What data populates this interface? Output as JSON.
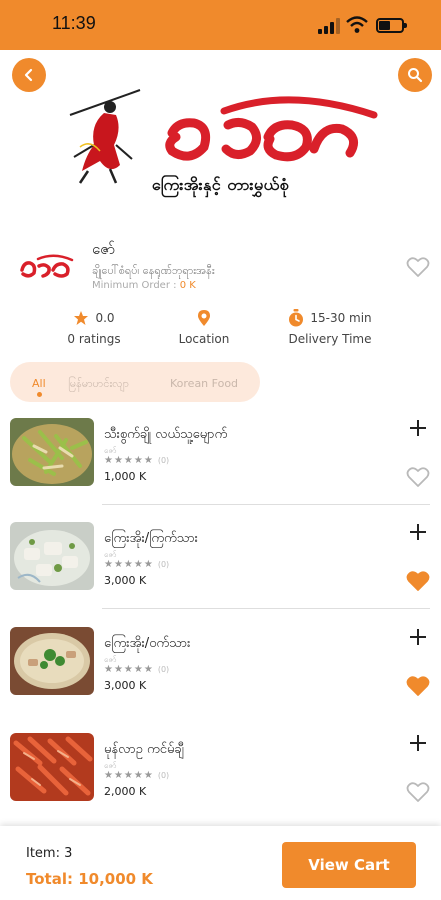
{
  "status_bar": {
    "time": "11:39"
  },
  "hero": {
    "brand_script": "ဇော်",
    "subtitle": "ကြေးအိုးနှင့် တားမွှယ်စုံ"
  },
  "restaurant": {
    "name": "ဇော်",
    "address": "ချိုပေါ်စံရပ်၊ နေရုဏ်ဘုရားအနီး",
    "min_order_label": "Minimum Order :",
    "min_order_value": "0 K",
    "rating_value": "0.0",
    "rating_label": "0 ratings",
    "location_label": "Location",
    "delivery_value": "15-30 min",
    "delivery_label": "Delivery Time"
  },
  "tabs": [
    {
      "label": "All",
      "active": true
    },
    {
      "label": "မြန်မာဟင်းလျာ",
      "active": false
    },
    {
      "label": "Korean Food",
      "active": false
    }
  ],
  "menu": [
    {
      "name": "သီးစွက်ချို လယ်သူ့မျောက်",
      "shop": "ဇော်",
      "stars": "★★★★★",
      "count": "(0)",
      "price": "1,000 K",
      "favorite": false,
      "image": "green-curry-dish"
    },
    {
      "name": "ကြေးအိုး/ကြက်သား",
      "shop": "ဇော်",
      "stars": "★★★★★",
      "count": "(0)",
      "price": "3,000 K",
      "favorite": true,
      "image": "chicken-hotpot"
    },
    {
      "name": "ကြေးအိုး/ဝက်သား",
      "shop": "ဇော်",
      "stars": "★★★★★",
      "count": "(0)",
      "price": "3,000 K",
      "favorite": true,
      "image": "pork-hotpot"
    },
    {
      "name": "မုန်လာဥ ကင်မ်ချီ",
      "shop": "ဇော်",
      "stars": "★★★★★",
      "count": "(0)",
      "price": "2,000 K",
      "favorite": false,
      "image": "radish-kimchi"
    }
  ],
  "footer": {
    "items_text": "Item: 3",
    "total_text": "Total: 10,000 K",
    "cart_button": "View Cart"
  },
  "colors": {
    "accent": "#f08a2c",
    "heart": "#f08a2c",
    "logo_red": "#d9202a"
  }
}
